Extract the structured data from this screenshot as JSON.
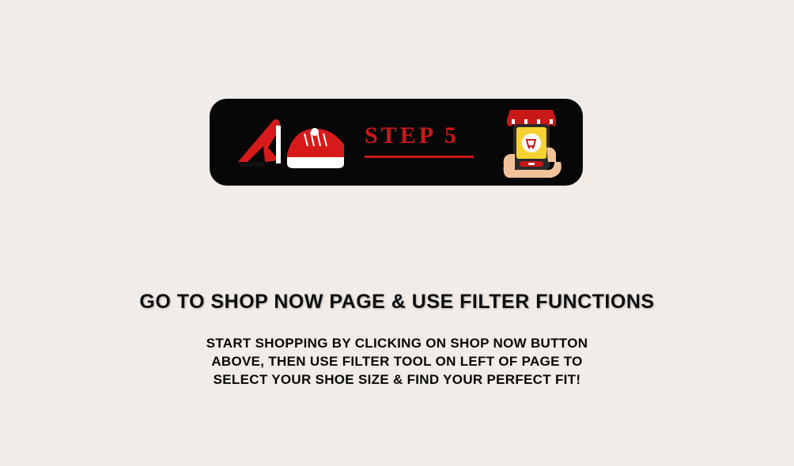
{
  "banner": {
    "step_label": "STEP 5"
  },
  "heading": "Go to Shop Now Page & Use Filter Functions",
  "body": "Start shopping by clicking on Shop Now button above, then use filter tool on left of page to select your shoe size & find your perfect fit!"
}
